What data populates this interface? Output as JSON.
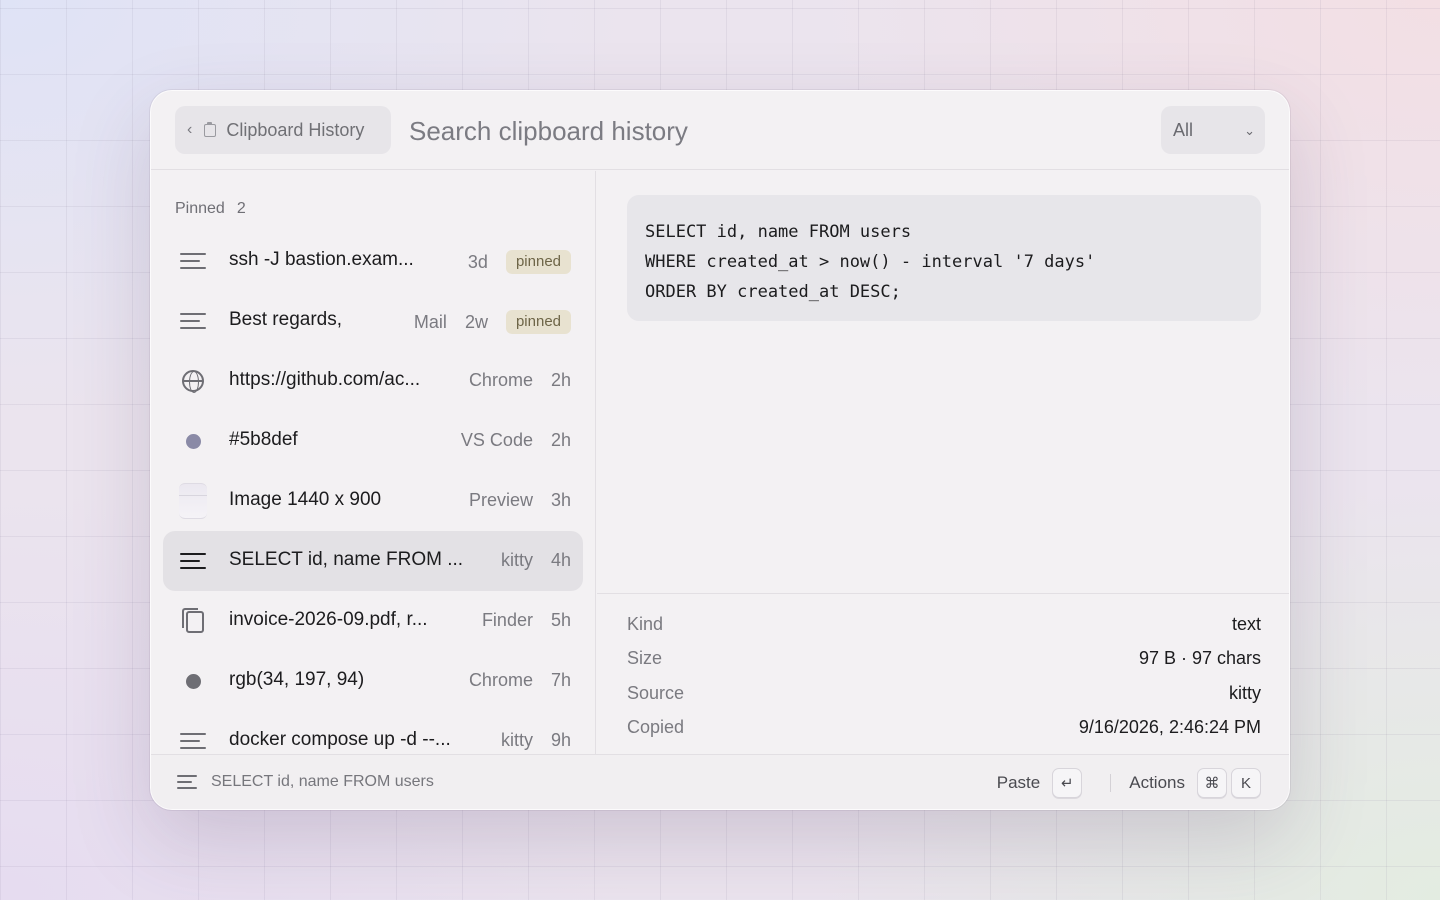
{
  "header": {
    "back_label": "Clipboard History",
    "search_placeholder": "Search clipboard history",
    "filter_value": "All"
  },
  "list": {
    "pinned_label": "Pinned",
    "pinned_count": "2",
    "items": [
      {
        "title": "ssh -J bastion.exam...",
        "source": "",
        "age": "3d",
        "badge": "pinned",
        "icon": "text-lines-icon"
      },
      {
        "title": "Best regards,",
        "source": "Mail",
        "age": "2w",
        "badge": "pinned",
        "icon": "text-lines-icon"
      },
      {
        "title": "https://github.com/ac...",
        "source": "Chrome",
        "age": "2h",
        "badge": "",
        "icon": "globe-icon"
      },
      {
        "title": "#5b8def",
        "source": "VS Code",
        "age": "2h",
        "badge": "",
        "icon": "color-swatch-icon",
        "swatch": "#8a8aa6"
      },
      {
        "title": "Image 1440 x 900",
        "source": "Preview",
        "age": "3h",
        "badge": "",
        "icon": "image-thumbnail-icon"
      },
      {
        "title": "SELECT id, name FROM ...",
        "source": "kitty",
        "age": "4h",
        "badge": "",
        "icon": "text-lines-icon",
        "selected": true
      },
      {
        "title": "invoice-2026-09.pdf, r...",
        "source": "Finder",
        "age": "5h",
        "badge": "",
        "icon": "files-icon"
      },
      {
        "title": "rgb(34, 197, 94)",
        "source": "Chrome",
        "age": "7h",
        "badge": "",
        "icon": "color-swatch-icon",
        "swatch": "#6e6e74"
      },
      {
        "title": "docker compose up -d --...",
        "source": "kitty",
        "age": "9h",
        "badge": "",
        "icon": "text-lines-icon"
      }
    ]
  },
  "preview": {
    "code_lines": [
      "SELECT id, name FROM users",
      "WHERE created_at > now() - interval '7 days'",
      "ORDER BY created_at DESC;"
    ],
    "details": [
      {
        "key": "Kind",
        "value": "text"
      },
      {
        "key": "Size",
        "value": "97 B · 97 chars"
      },
      {
        "key": "Source",
        "value": "kitty"
      },
      {
        "key": "Copied",
        "value": "9/16/2026, 2:46:24 PM"
      }
    ]
  },
  "footer": {
    "selection_text": "SELECT id, name FROM users",
    "paste_label": "Paste",
    "paste_key": "↵",
    "actions_label": "Actions",
    "actions_key_1": "⌘",
    "actions_key_2": "K"
  },
  "colors": {
    "accent_badge_bg": "#e8e2d0",
    "selected_row_bg": "#e3e1e5"
  }
}
